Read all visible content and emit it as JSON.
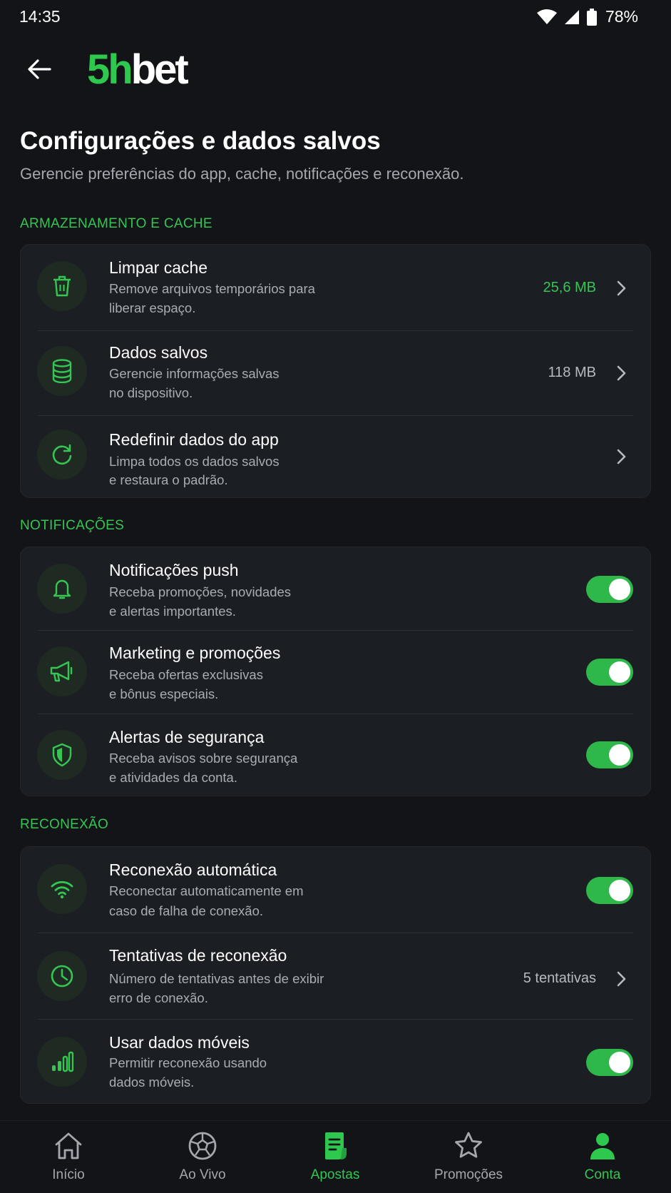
{
  "status_bar": {
    "time": "14:35",
    "battery": "78%"
  },
  "header": {
    "logo_prefix": "5h",
    "logo_suffix": "bet"
  },
  "page": {
    "title": "Configurações e dados salvos",
    "subtitle": "Gerencie preferências do app, cache, notificações e reconexão."
  },
  "sections": {
    "storage": {
      "label": "ARMAZENAMENTO E CACHE",
      "items": [
        {
          "title": "Limpar cache",
          "desc1": "Remove arquivos temporários para",
          "desc2": "liberar espaço.",
          "value": "25,6 MB"
        },
        {
          "title": "Dados salvos",
          "desc1": "Gerencie informações salvas",
          "desc2": "no dispositivo.",
          "value": "118 MB"
        },
        {
          "title": "Redefinir dados do app",
          "desc1": "Limpa todos os dados salvos",
          "desc2": "e restaura o padrão."
        }
      ]
    },
    "notifications": {
      "label": "NOTIFICAÇÕES",
      "items": [
        {
          "title": "Notificações push",
          "desc1": "Receba promoções, novidades",
          "desc2": "e alertas importantes.",
          "enabled": true
        },
        {
          "title": "Marketing e promoções",
          "desc1": "Receba ofertas exclusivas",
          "desc2": "e bônus especiais.",
          "enabled": true
        },
        {
          "title": "Alertas de segurança",
          "desc1": "Receba avisos sobre segurança",
          "desc2": "e atividades da conta.",
          "enabled": true
        }
      ]
    },
    "reconnection": {
      "label": "RECONEXÃO",
      "items": [
        {
          "title": "Reconexão automática",
          "desc1": "Reconectar automaticamente em",
          "desc2": "caso de falha de conexão.",
          "enabled": true
        },
        {
          "title": "Tentativas de reconexão",
          "desc1": "Número de tentativas antes de exibir",
          "desc2": "erro de conexão.",
          "value": "5 tentativas"
        },
        {
          "title": "Usar dados móveis",
          "desc1": "Permitir reconexão usando",
          "desc2": "dados móveis.",
          "enabled": true
        }
      ]
    }
  },
  "bottom_nav": {
    "items": [
      {
        "label": "Início",
        "icon": "home-icon"
      },
      {
        "label": "Ao Vivo",
        "icon": "soccer-ball-icon"
      },
      {
        "label": "Apostas",
        "icon": "bet-slip-icon",
        "active": true
      },
      {
        "label": "Promoções",
        "icon": "star-icon"
      },
      {
        "label": "Conta",
        "icon": "user-icon",
        "active": true
      }
    ]
  },
  "colors": {
    "accent": "#2fc84e",
    "background": "#121417",
    "card": "#1b1e23"
  }
}
